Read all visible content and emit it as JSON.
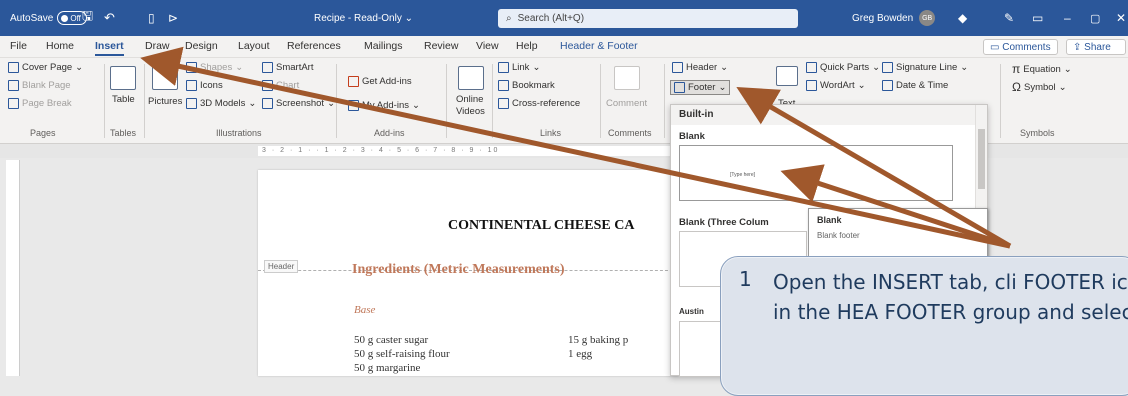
{
  "titlebar": {
    "autosave_label": "AutoSave",
    "autosave_state": "Off",
    "doc_title": "Recipe - Read-Only",
    "search_placeholder": "Search (Alt+Q)",
    "user_name": "Greg Bowden",
    "user_initials": "GB"
  },
  "tabs": [
    "File",
    "Home",
    "Insert",
    "Draw",
    "Design",
    "Layout",
    "References",
    "Mailings",
    "Review",
    "View",
    "Help",
    "Header & Footer"
  ],
  "active_tab": "Insert",
  "share": {
    "comments": "Comments",
    "share": "Share"
  },
  "ribbon": {
    "pages": {
      "cover": "Cover Page",
      "blank": "Blank Page",
      "break": "Page Break",
      "group": "Pages"
    },
    "tables": {
      "table": "Table",
      "group": "Tables"
    },
    "illustrations": {
      "pictures": "Pictures",
      "shapes": "Shapes",
      "icons": "Icons",
      "models": "3D Models",
      "smartart": "SmartArt",
      "chart": "Chart",
      "screenshot": "Screenshot",
      "group": "Illustrations"
    },
    "addins": {
      "get": "Get Add-ins",
      "my": "My Add-ins",
      "group": "Add-ins"
    },
    "media": {
      "online": "Online",
      "videos": "Videos"
    },
    "links": {
      "link": "Link",
      "bookmark": "Bookmark",
      "crossref": "Cross-reference",
      "group": "Links"
    },
    "comments": {
      "comment": "Comment",
      "group": "Comments"
    },
    "header": {
      "header": "Header",
      "footer": "Footer"
    },
    "text": {
      "text": "Text",
      "quick": "Quick Parts",
      "wordart": "WordArt",
      "sig": "Signature Line",
      "date": "Date & Time"
    },
    "symbols": {
      "equation": "Equation",
      "symbol": "Symbol",
      "group": "Symbols"
    }
  },
  "ruler_text": "3 · 2 · 1 · · 1 · 2 · 3 · 4 · 5 · 6 · 7 · 8 · 9 · 10",
  "document": {
    "title": "CONTINENTAL CHEESE CA",
    "header_tag": "Header",
    "heading": "Ingredients (Metric Measurements)",
    "base": "Base",
    "lines_left": [
      "50 g caster sugar",
      "50 g self-raising flour",
      "50 g margarine"
    ],
    "lines_right": [
      "15 g baking p",
      "1 egg"
    ]
  },
  "gallery": {
    "section": "Built-in",
    "blank": "Blank",
    "blank_three": "Blank (Three Colum",
    "austin": "Austin",
    "thumb_text": "[Type here]",
    "tooltip_title": "Blank",
    "tooltip_desc": "Blank footer"
  },
  "callout": {
    "step": "1",
    "text": "Open the INSERT tab, cli FOOTER icon in the HEA FOOTER group and selec"
  }
}
